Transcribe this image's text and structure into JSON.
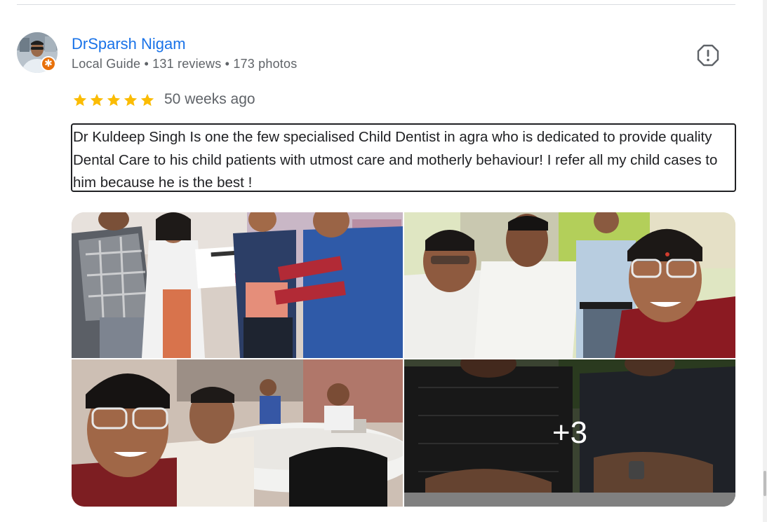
{
  "reviewer": {
    "name": "DrSparsh Nigam",
    "meta": "Local Guide • 131 reviews • 173 photos",
    "badge_icon": "local-guide-star-icon"
  },
  "review": {
    "rating": 5,
    "max_rating": 5,
    "time_ago": "50 weeks ago",
    "text": "Dr Kuldeep Singh Is one the few specialised Child Dentist in agra who is dedicated to provide quality Dental Care to his child patients with utmost care and motherly behaviour! I refer all my child cases to him because he is the best !"
  },
  "actions": {
    "flag_icon": "report-review-icon"
  },
  "photos": {
    "more_count_label": "+3",
    "items": [
      {
        "name": "certificate-ceremony-photo"
      },
      {
        "name": "group-selfie-photo"
      },
      {
        "name": "conference-selfie-photo"
      },
      {
        "name": "clinic-photo"
      }
    ]
  },
  "colors": {
    "link_blue": "#1a73e8",
    "star_yellow": "#fbbc04",
    "meta_gray": "#5f6368",
    "text_dark": "#202124",
    "badge_orange": "#e8710a"
  }
}
